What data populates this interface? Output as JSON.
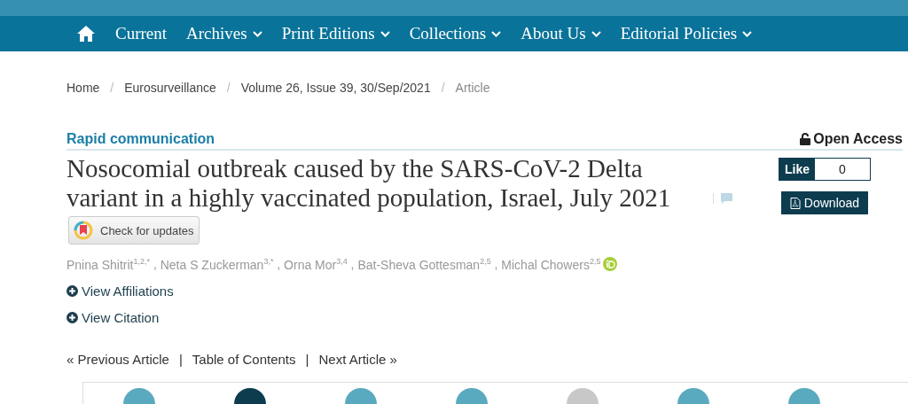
{
  "nav": {
    "items": [
      {
        "label": "Current",
        "dropdown": false
      },
      {
        "label": "Archives",
        "dropdown": true
      },
      {
        "label": "Print Editions",
        "dropdown": true
      },
      {
        "label": "Collections",
        "dropdown": true
      },
      {
        "label": "About Us",
        "dropdown": true
      },
      {
        "label": "Editorial Policies",
        "dropdown": true
      }
    ]
  },
  "breadcrumb_separator": "/",
  "author_separator": ",",
  "pager_separator": "|",
  "breadcrumb": [
    {
      "label": "Home",
      "current": false
    },
    {
      "label": "Eurosurveillance",
      "current": false
    },
    {
      "label": "Volume 26, Issue 39, 30/Sep/2021",
      "current": false
    },
    {
      "label": "Article",
      "current": true
    }
  ],
  "article": {
    "type": "Rapid communication",
    "access": "Open Access",
    "title": "Nosocomial outbreak caused by the SARS-CoV-2 Delta variant in a highly vaccinated population, Israel, July 2021",
    "check_updates": "Check for updates",
    "like": {
      "label": "Like",
      "count": "0"
    },
    "download": "Download",
    "authors": [
      {
        "name": "Pnina Shitrit$^{1,2,*}$",
        "orcid": false
      },
      {
        "name": "Neta S Zuckerman$^{3,*}$",
        "orcid": false
      },
      {
        "name": "Orna Mor$^{3,4}$",
        "orcid": false
      },
      {
        "name": "Bat-Sheva Gottesman$^{2,5}$",
        "orcid": false
      },
      {
        "name": "Michal Chowers$^{2,5}$",
        "orcid": true
      }
    ],
    "toggles": [
      "View Affiliations",
      "View Citation"
    ],
    "pager": {
      "previous": "« Previous Article",
      "contents": "Table of Contents",
      "next": "Next Article »"
    },
    "share_buttons": [
      {
        "color": "#5aaabf"
      },
      {
        "color": "#0d3c4f"
      },
      {
        "color": "#5aaabf"
      },
      {
        "color": "#5aaabf"
      },
      {
        "color": "#c8c8c8"
      },
      {
        "color": "#5aaabf"
      },
      {
        "color": "#5aaabf"
      }
    ]
  }
}
